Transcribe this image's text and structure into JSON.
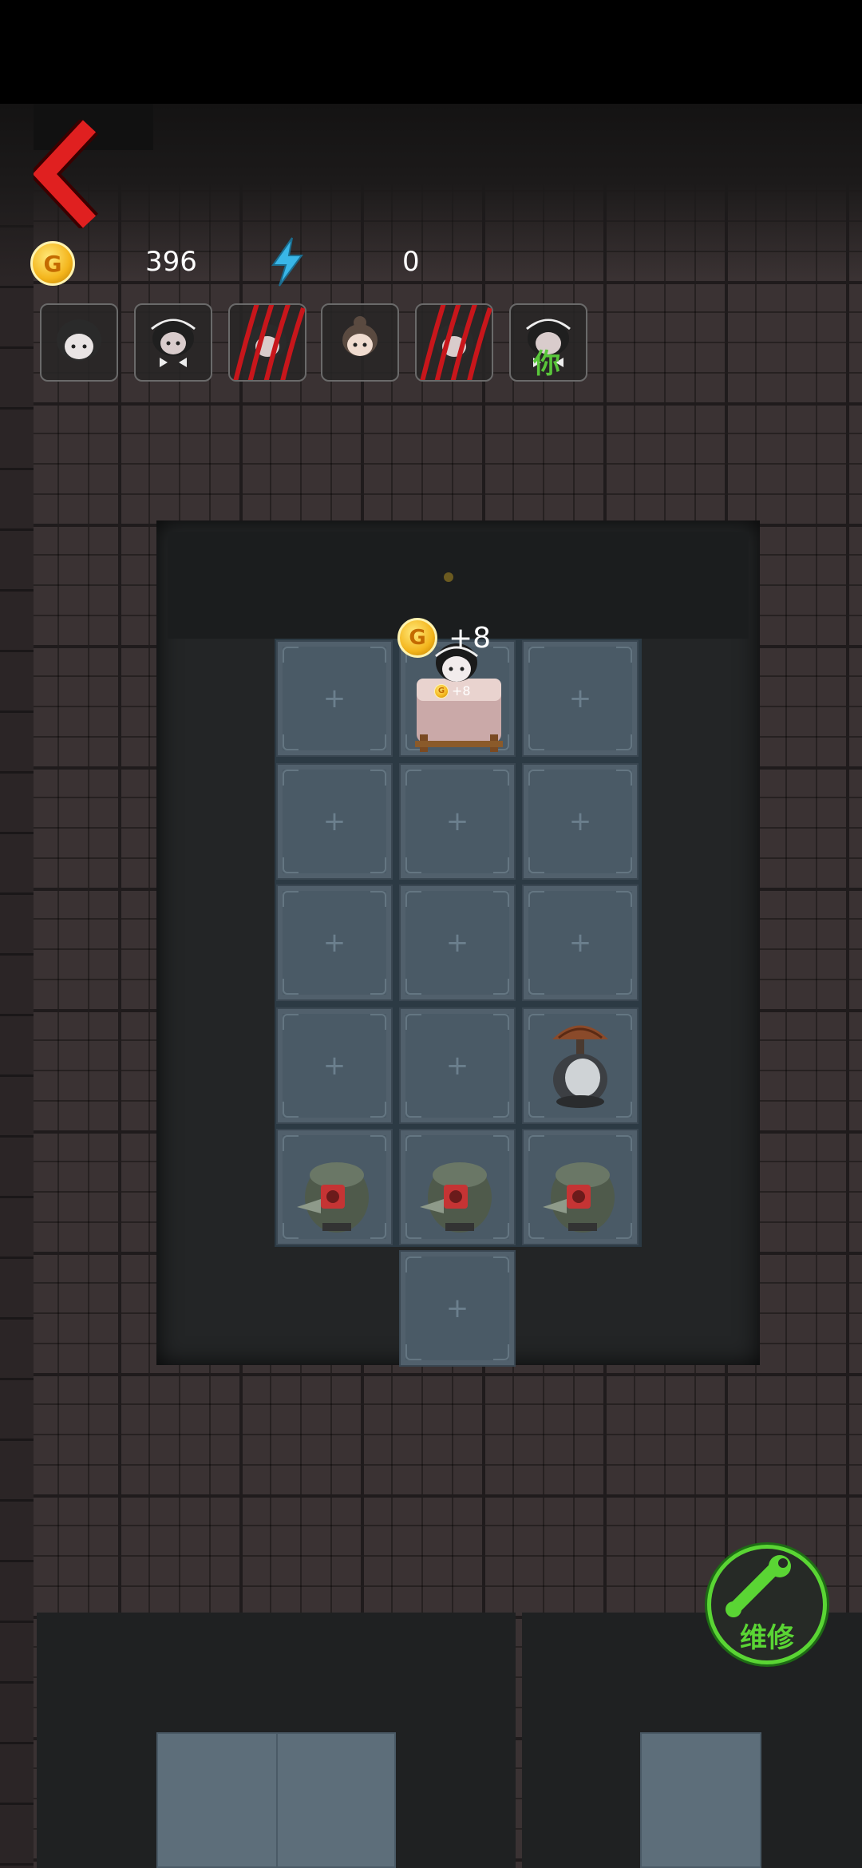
{
  "hud": {
    "gold_value": "396",
    "energy_value": "0",
    "coin_letter": "G"
  },
  "gold_popup": {
    "text": "+8",
    "small_text": "+8"
  },
  "avatars": [
    {
      "name": "pale-girl-avatar",
      "state": "normal"
    },
    {
      "name": "bow-girl-avatar",
      "state": "normal"
    },
    {
      "name": "scratched-avatar",
      "state": "scratched"
    },
    {
      "name": "bun-girl-avatar",
      "state": "normal"
    },
    {
      "name": "scratched-avatar",
      "state": "scratched"
    },
    {
      "name": "you-avatar",
      "state": "player",
      "label": "你"
    }
  ],
  "repair_button": {
    "label": "维修"
  },
  "colors": {
    "accent_green": "#5ad534",
    "back_red": "#e02020",
    "scratch_red": "#c8161b",
    "tile": "#4a5a66"
  }
}
